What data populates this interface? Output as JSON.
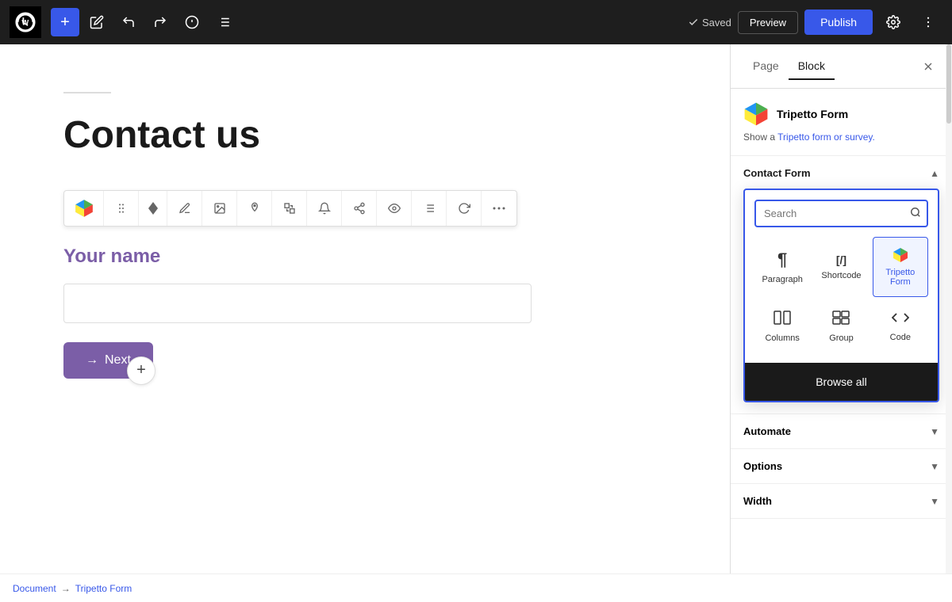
{
  "toolbar": {
    "add_label": "+",
    "saved_label": "Saved",
    "preview_label": "Preview",
    "publish_label": "Publish"
  },
  "sidebar": {
    "tab_page": "Page",
    "tab_block": "Block",
    "active_tab": "Block",
    "block_name": "Tripetto Form",
    "block_desc_prefix": "Show a ",
    "block_desc_link": "Tripetto form or survey.",
    "block_desc_link_href": "#",
    "contact_form_section": "Contact Form",
    "automate_section": "Automate",
    "options_section": "Options",
    "width_section": "Width"
  },
  "search_popup": {
    "placeholder": "Search",
    "blocks": [
      {
        "id": "paragraph",
        "label": "Paragraph",
        "icon": "¶"
      },
      {
        "id": "shortcode",
        "label": "Shortcode",
        "icon": "[/]"
      },
      {
        "id": "tripetto",
        "label": "Tripetto Form",
        "icon": "tripetto",
        "selected": true
      },
      {
        "id": "columns",
        "label": "Columns",
        "icon": "columns"
      },
      {
        "id": "group",
        "label": "Group",
        "icon": "group"
      },
      {
        "id": "code",
        "label": "Code",
        "icon": "</>"
      }
    ],
    "browse_all_label": "Browse all"
  },
  "editor": {
    "page_title": "Contact us",
    "form_label": "Your name",
    "form_input_placeholder": "",
    "next_label": "Next"
  },
  "breadcrumb": {
    "document": "Document",
    "separator": "→",
    "current": "Tripetto Form"
  }
}
